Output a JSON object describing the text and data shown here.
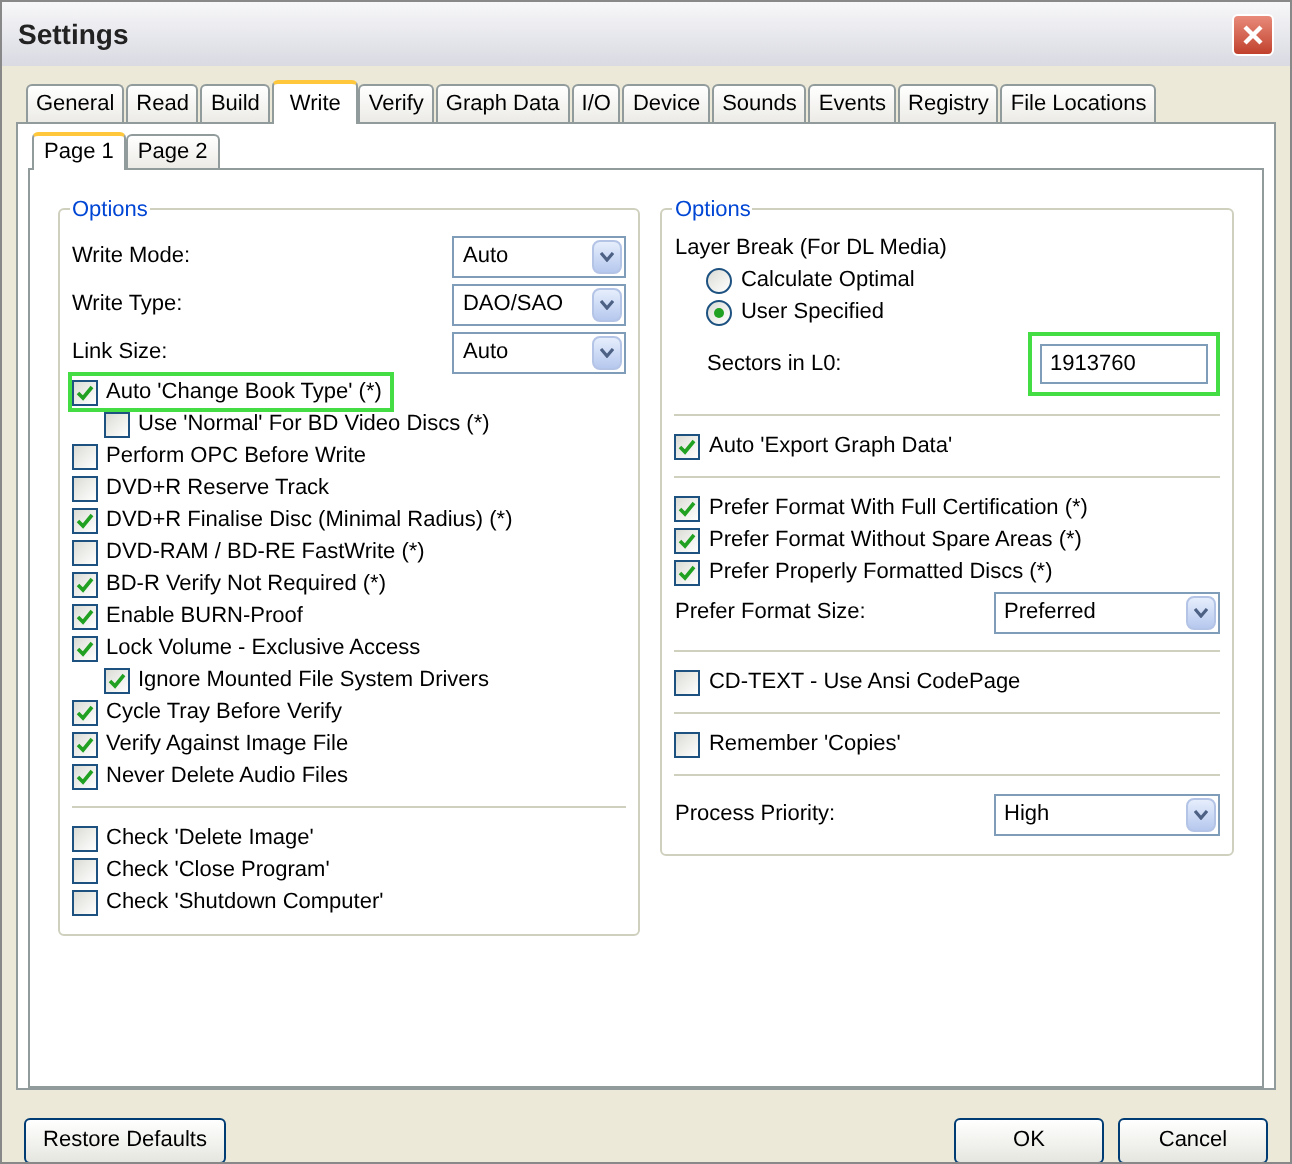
{
  "window": {
    "title": "Settings"
  },
  "tabs": [
    {
      "label": "General",
      "selected": false
    },
    {
      "label": "Read",
      "selected": false
    },
    {
      "label": "Build",
      "selected": false
    },
    {
      "label": "Write",
      "selected": true
    },
    {
      "label": "Verify",
      "selected": false
    },
    {
      "label": "Graph Data",
      "selected": false
    },
    {
      "label": "I/O",
      "selected": false
    },
    {
      "label": "Device",
      "selected": false
    },
    {
      "label": "Sounds",
      "selected": false
    },
    {
      "label": "Events",
      "selected": false
    },
    {
      "label": "Registry",
      "selected": false
    },
    {
      "label": "File Locations",
      "selected": false
    }
  ],
  "subtabs": [
    {
      "label": "Page 1",
      "selected": true
    },
    {
      "label": "Page 2",
      "selected": false
    }
  ],
  "left_group": {
    "title": "Options",
    "items": [
      {
        "kind": "select",
        "label": "Write Mode:",
        "value": "Auto"
      },
      {
        "kind": "select",
        "label": "Write Type:",
        "value": "DAO/SAO"
      },
      {
        "kind": "select",
        "label": "Link Size:",
        "value": "Auto"
      },
      {
        "kind": "checkbox",
        "label": "Auto 'Change Book Type' (*)",
        "checked": true,
        "highlighted": true,
        "children": [
          {
            "kind": "checkbox",
            "label": "Use 'Normal' For BD Video Discs (*)",
            "checked": false,
            "highlighted": false
          }
        ]
      },
      {
        "kind": "checkbox",
        "label": "Perform OPC Before Write",
        "checked": false,
        "highlighted": false
      },
      {
        "kind": "checkbox",
        "label": "DVD+R Reserve Track",
        "checked": false,
        "highlighted": false
      },
      {
        "kind": "checkbox",
        "label": "DVD+R Finalise Disc (Minimal Radius) (*)",
        "checked": true,
        "highlighted": false
      },
      {
        "kind": "checkbox",
        "label": "DVD-RAM / BD-RE FastWrite (*)",
        "checked": false,
        "highlighted": false
      },
      {
        "kind": "checkbox",
        "label": "BD-R Verify Not Required (*)",
        "checked": true,
        "highlighted": false
      },
      {
        "kind": "checkbox",
        "label": "Enable BURN-Proof",
        "checked": true,
        "highlighted": false
      },
      {
        "kind": "checkbox",
        "label": "Lock Volume - Exclusive Access",
        "checked": true,
        "highlighted": false,
        "children": [
          {
            "kind": "checkbox",
            "label": "Ignore Mounted File System Drivers",
            "checked": true,
            "highlighted": false
          }
        ]
      },
      {
        "kind": "checkbox",
        "label": "Cycle Tray Before Verify",
        "checked": true,
        "highlighted": false
      },
      {
        "kind": "checkbox",
        "label": "Verify Against Image File",
        "checked": true,
        "highlighted": false
      },
      {
        "kind": "checkbox",
        "label": "Never Delete Audio Files",
        "checked": true,
        "highlighted": false
      },
      {
        "kind": "divider"
      },
      {
        "kind": "checkbox",
        "label": "Check 'Delete Image'",
        "checked": false,
        "highlighted": false
      },
      {
        "kind": "checkbox",
        "label": "Check 'Close Program'",
        "checked": false,
        "highlighted": false
      },
      {
        "kind": "checkbox",
        "label": "Check 'Shutdown Computer'",
        "checked": false,
        "highlighted": false
      }
    ]
  },
  "right_group": {
    "title": "Options",
    "items": [
      {
        "kind": "label",
        "label": "Layer Break (For DL Media)"
      },
      {
        "kind": "radio",
        "label": "Calculate Optimal",
        "selected": false
      },
      {
        "kind": "radio",
        "label": "User Specified",
        "selected": true
      },
      {
        "kind": "field",
        "label": "Sectors in L0:",
        "value": "1913760",
        "highlighted": true
      },
      {
        "kind": "divider"
      },
      {
        "kind": "checkbox",
        "label": "Auto 'Export Graph Data'",
        "checked": true,
        "highlighted": false
      },
      {
        "kind": "divider"
      },
      {
        "kind": "checkbox",
        "label": "Prefer Format With Full Certification (*)",
        "checked": true,
        "highlighted": false
      },
      {
        "kind": "checkbox",
        "label": "Prefer Format Without Spare Areas (*)",
        "checked": true,
        "highlighted": false
      },
      {
        "kind": "checkbox",
        "label": "Prefer Properly Formatted Discs (*)",
        "checked": true,
        "highlighted": false
      },
      {
        "kind": "select",
        "label": "Prefer Format Size:",
        "value": "Preferred"
      },
      {
        "kind": "divider"
      },
      {
        "kind": "checkbox",
        "label": "CD-TEXT - Use Ansi CodePage",
        "checked": false,
        "highlighted": false
      },
      {
        "kind": "divider"
      },
      {
        "kind": "checkbox",
        "label": "Remember 'Copies'",
        "checked": false,
        "highlighted": false
      },
      {
        "kind": "divider"
      },
      {
        "kind": "select",
        "label": "Process Priority:",
        "value": "High"
      }
    ]
  },
  "buttons": {
    "left": "Restore Defaults",
    "ok": "OK",
    "cancel": "Cancel"
  }
}
